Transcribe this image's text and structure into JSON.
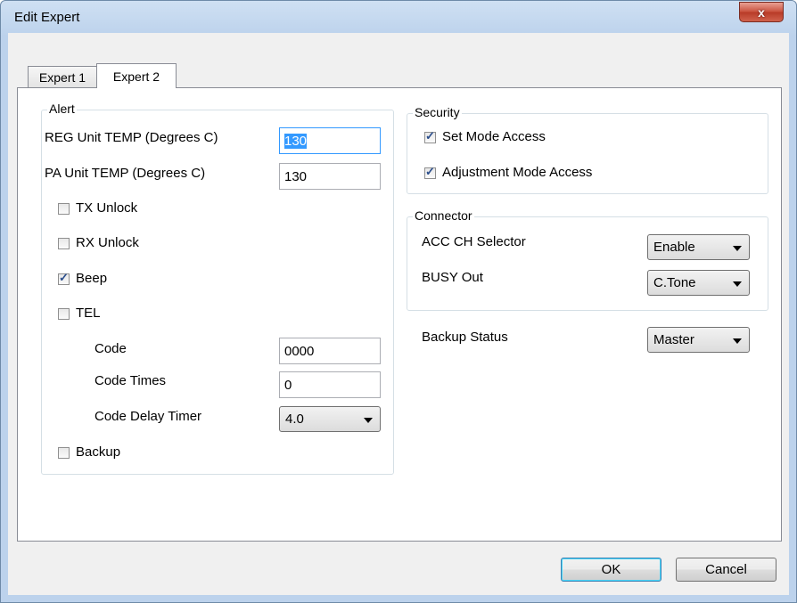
{
  "window": {
    "title": "Edit Expert",
    "close_glyph": "x"
  },
  "tabs": [
    {
      "label": "Expert 1"
    },
    {
      "label": "Expert 2"
    }
  ],
  "alert": {
    "legend": "Alert",
    "reg_temp_label": "REG Unit TEMP (Degrees C)",
    "reg_temp_value": "130",
    "pa_temp_label": "PA Unit TEMP (Degrees C)",
    "pa_temp_value": "130",
    "tx_unlock_label": "TX Unlock",
    "rx_unlock_label": "RX Unlock",
    "beep_label": "Beep",
    "tel_label": "TEL",
    "code_label": "Code",
    "code_value": "0000",
    "code_times_label": "Code Times",
    "code_times_value": "0",
    "code_delay_label": "Code Delay Timer",
    "code_delay_value": "4.0",
    "backup_label": "Backup",
    "checked": {
      "tx_unlock": false,
      "rx_unlock": false,
      "beep": true,
      "tel": false,
      "backup": false
    }
  },
  "security": {
    "legend": "Security",
    "set_mode_label": "Set Mode Access",
    "adjustment_mode_label": "Adjustment Mode Access",
    "checked": {
      "set_mode": true,
      "adjustment_mode": true
    }
  },
  "connector": {
    "legend": "Connector",
    "acc_ch_label": "ACC CH Selector",
    "acc_ch_value": "Enable",
    "busy_out_label": "BUSY Out",
    "busy_out_value": "C.Tone"
  },
  "backup_status": {
    "label": "Backup Status",
    "value": "Master"
  },
  "buttons": {
    "ok": "OK",
    "cancel": "Cancel"
  },
  "colors": {
    "selection": "#3399ff",
    "titlebar": "#bcd2ec",
    "close": "#c9503c"
  }
}
